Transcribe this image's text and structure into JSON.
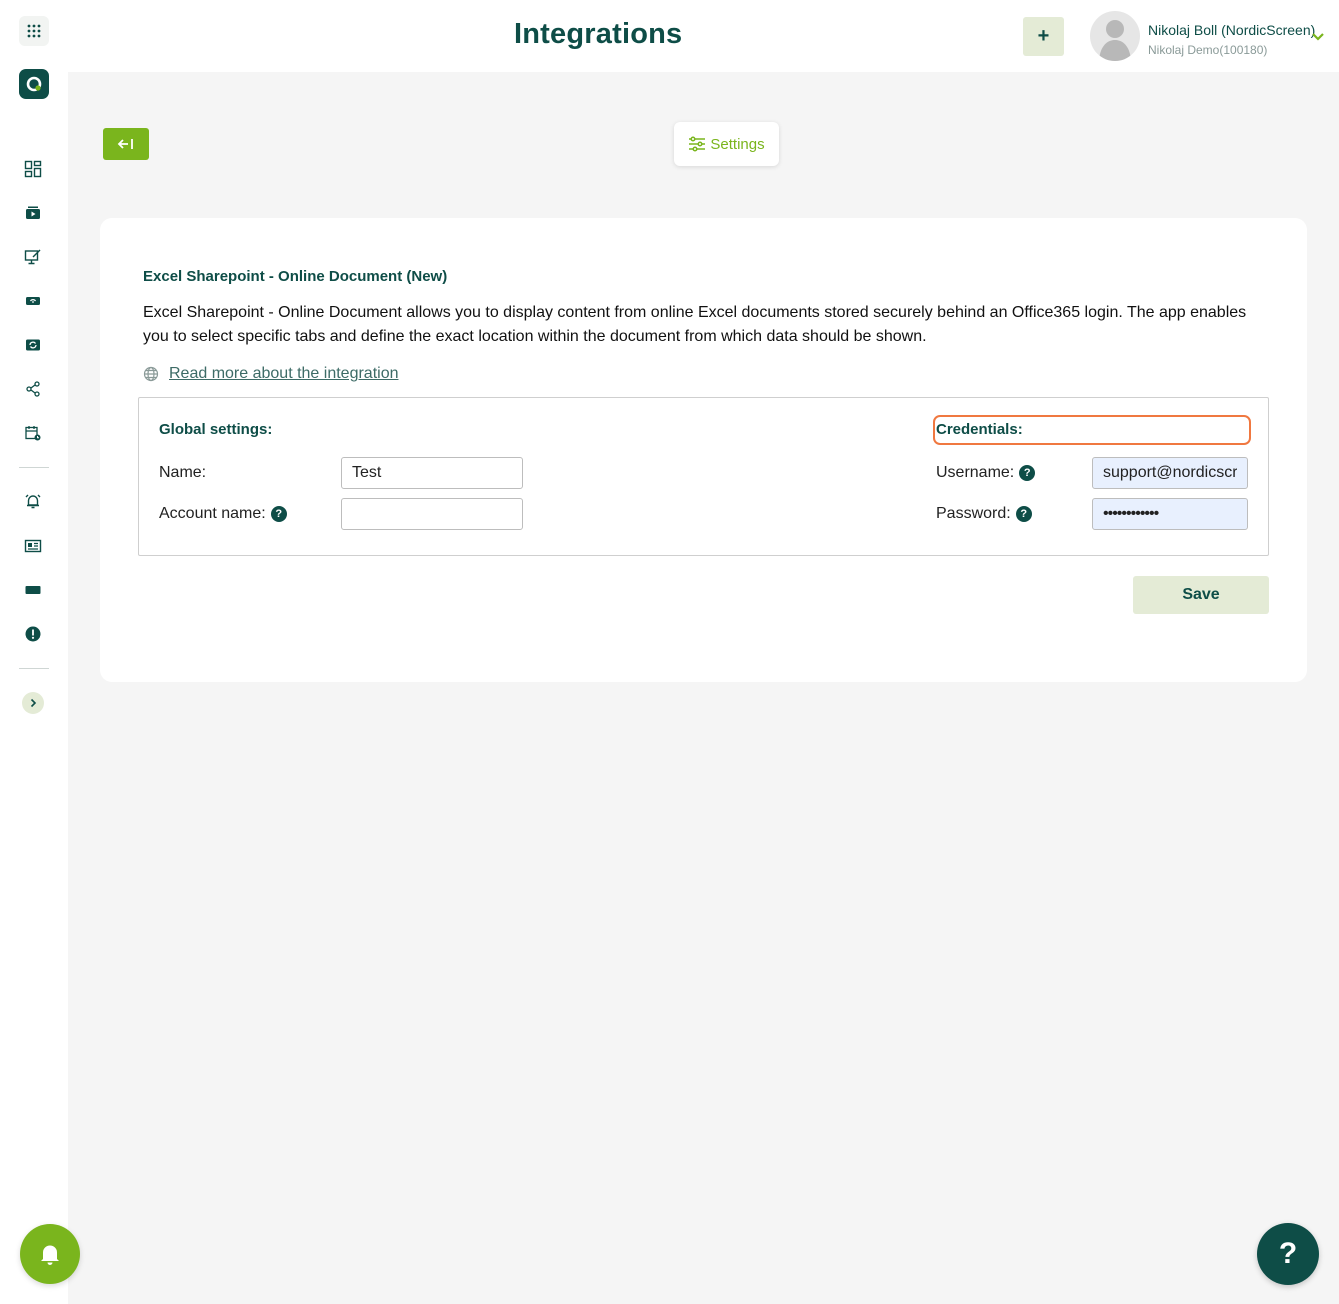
{
  "header": {
    "title": "Integrations",
    "add_label": "+",
    "user_name": "Nikolaj Boll (NordicScreen)",
    "user_org": "Nikolaj Demo(100180)"
  },
  "subnav": {
    "settings_tab": "Settings"
  },
  "integration": {
    "title": "Excel Sharepoint - Online Document (New)",
    "description": "Excel Sharepoint - Online Document allows you to display content from online Excel documents stored securely behind an Office365 login. The app enables you to select specific tabs and define the exact location within the document from which data should be shown.",
    "read_more": "Read more about the integration"
  },
  "global_settings": {
    "heading": "Global settings:",
    "name_label": "Name:",
    "name_value": "Test",
    "account_label": "Account name:",
    "account_value": ""
  },
  "credentials": {
    "heading": "Credentials:",
    "username_label": "Username:",
    "username_value": "support@nordicscr",
    "password_label": "Password:",
    "password_value": "••••••••••••"
  },
  "actions": {
    "save": "Save",
    "help": "?"
  },
  "colors": {
    "brand_dark": "#0e4d47",
    "brand_green": "#7ab51d",
    "light_green": "#e4ebd6",
    "highlight": "#f07840"
  }
}
